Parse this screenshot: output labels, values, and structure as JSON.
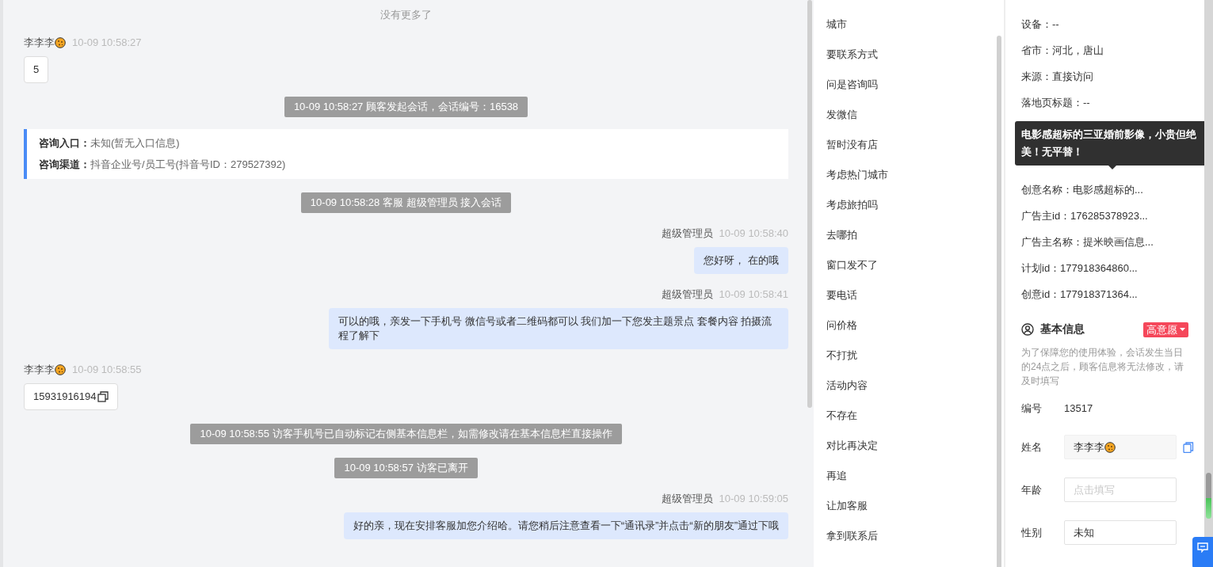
{
  "chat": {
    "top_notice": "没有更多了",
    "messages": [
      {
        "kind": "customer",
        "name": "李李李",
        "time": "10-09 10:58:27",
        "text": "5",
        "copyable": false
      },
      {
        "kind": "system",
        "text": "10-09 10:58:27 顾客发起会话，会话编号：16538"
      },
      {
        "kind": "entry",
        "lines": [
          {
            "label": "咨询入口：",
            "value": "未知(暂无入口信息)"
          },
          {
            "label": "咨询渠道：",
            "value": "抖音企业号/员工号(抖音号ID：279527392)"
          }
        ]
      },
      {
        "kind": "system",
        "text": "10-09 10:58:28 客服 超级管理员 接入会话"
      },
      {
        "kind": "agent",
        "name": "超级管理员",
        "time": "10-09 10:58:40",
        "text": "您好呀， 在的哦"
      },
      {
        "kind": "agent",
        "name": "超级管理员",
        "time": "10-09 10:58:41",
        "text": "可以的哦，亲发一下手机号 微信号或者二维码都可以 我们加一下您发主题景点 套餐内容 拍摄流程了解下"
      },
      {
        "kind": "customer",
        "name": "李李李",
        "time": "10-09 10:58:55",
        "text": "15931916194",
        "copyable": true
      },
      {
        "kind": "system",
        "text": "10-09 10:58:55 访客手机号已自动标记右侧基本信息栏，如需修改请在基本信息栏直接操作"
      },
      {
        "kind": "system",
        "text": "10-09 10:58:57 访客已离开"
      },
      {
        "kind": "agent",
        "name": "超级管理员",
        "time": "10-09 10:59:05",
        "text": "好的亲，现在安排客服加您介绍哈。请您稍后注意查看一下“通讯录”并点击“新的朋友”通过下哦"
      }
    ]
  },
  "quick_replies": [
    "城市",
    "要联系方式",
    "问是咨询吗",
    "发微信",
    "暂时没有店",
    "考虑热门城市",
    "考虑旅拍吗",
    "去哪拍",
    "窗口发不了",
    "要电话",
    "问价格",
    "不打扰",
    "活动内容",
    "不存在",
    "对比再决定",
    "再追",
    "让加客服",
    "拿到联系后"
  ],
  "visitor_info": {
    "rows_above": [
      "设备：--",
      "省市：河北，唐山",
      "来源：直接访问",
      "落地页标题：--"
    ],
    "tooltip": "电影感超标的三亚婚前影像，小贵但绝美！无平替！",
    "rows_below": [
      "创意名称：电影感超标的...",
      "广告主id：176285378923...",
      "广告主名称：提米映画信息...",
      "计划id：177918364860...",
      "创意id：177918371364..."
    ]
  },
  "basic_info": {
    "title": "基本信息",
    "intent": "高意愿",
    "notice": "为了保障您的使用体验，会话发生当日的24点之后，顾客信息将无法修改，请及时填写",
    "number_label": "编号",
    "number": "13517",
    "fields": [
      {
        "label": "姓名",
        "value": "李李李",
        "readonly": true
      },
      {
        "label": "年龄",
        "placeholder": "点击填写",
        "readonly": false
      },
      {
        "label": "性别",
        "value": "未知",
        "readonly": false
      }
    ]
  }
}
